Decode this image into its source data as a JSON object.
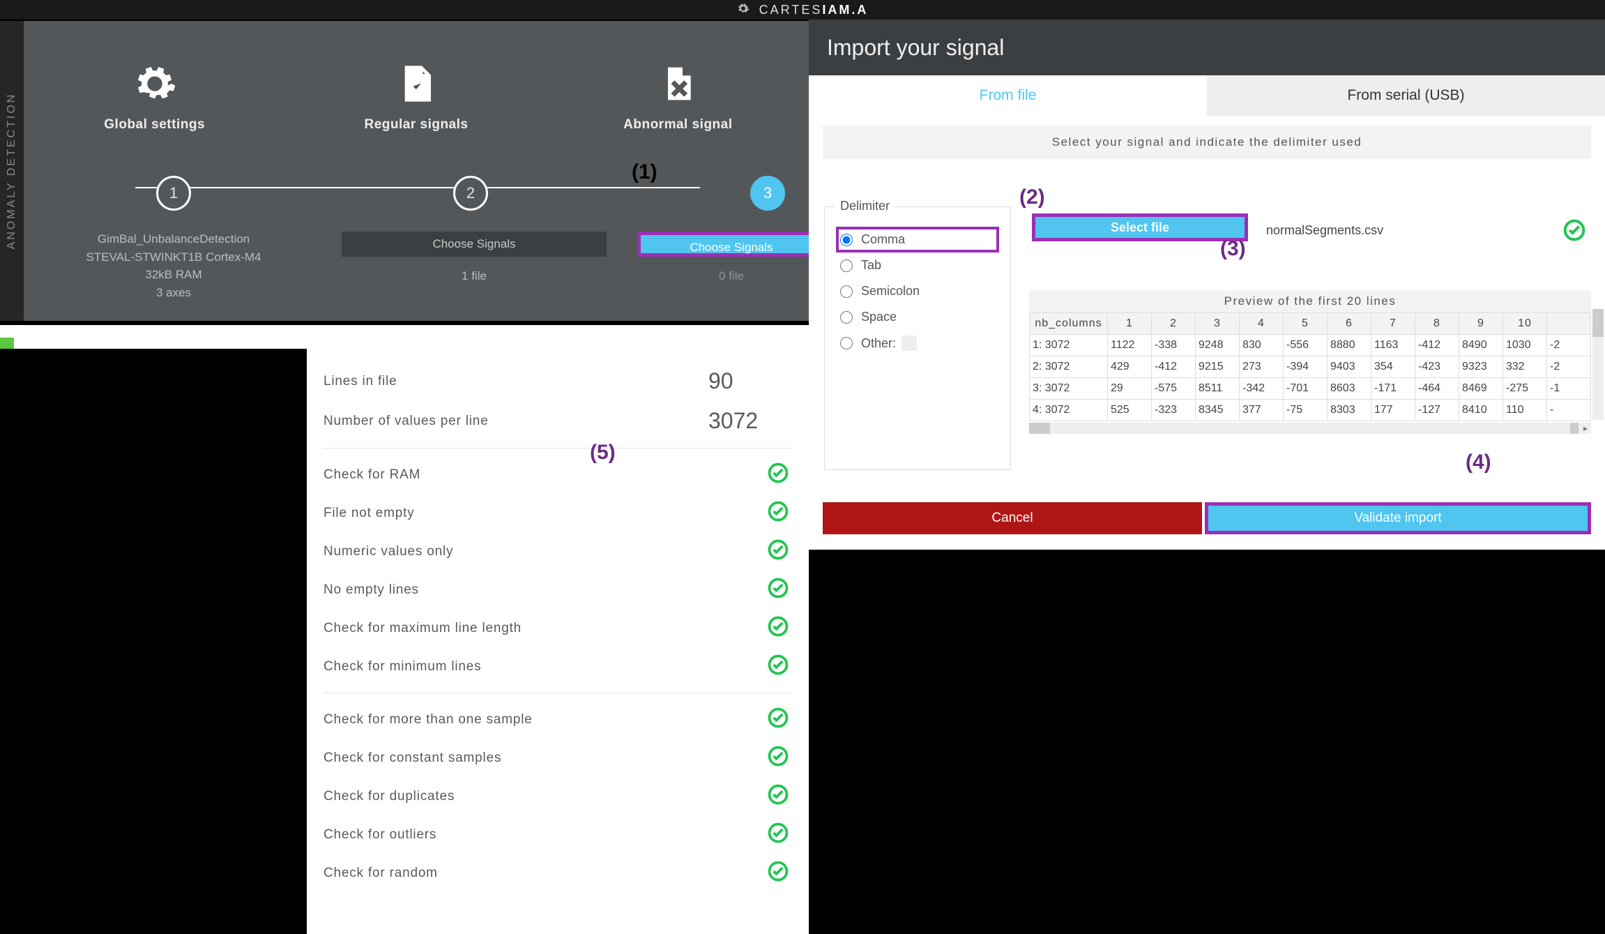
{
  "brand": {
    "pre": "CARTES",
    "bold": "IAM.A"
  },
  "side_label": "ANOMALY DETECTION",
  "wizard": {
    "cols": [
      {
        "title": "Global settings"
      },
      {
        "title": "Regular signals"
      },
      {
        "title": "Abnormal signal"
      }
    ],
    "settings_lines": [
      "GimBal_UnbalanceDetection",
      "STEVAL-STWINKT1B Cortex-M4",
      "32kB RAM",
      "3 axes"
    ],
    "choose1": "Choose Signals",
    "choose2": "Choose Signals",
    "fc1": "1 file",
    "fc2": "0 file"
  },
  "validation": {
    "lines_label": "Lines in file",
    "lines_value": "90",
    "nvals_label": "Number of values per line",
    "nvals_value": "3072",
    "checks_a": [
      "Check for RAM",
      "File not empty",
      "Numeric values only",
      "No empty lines",
      "Check for maximum line length",
      "Check for minimum lines"
    ],
    "checks_b": [
      "Check for more than one sample",
      "Check for constant samples",
      "Check for duplicates",
      "Check for outliers",
      "Check for random"
    ]
  },
  "modal": {
    "title": "Import your signal",
    "tab_file": "From file",
    "tab_serial": "From serial (USB)",
    "hint": "Select your signal and indicate the delimiter used",
    "delimiter_legend": "Delimiter",
    "delims": [
      "Comma",
      "Tab",
      "Semicolon",
      "Space",
      "Other:"
    ],
    "select_file": "Select file",
    "filename": "normalSegments.csv",
    "preview_title": "Preview of the first 20 lines",
    "headers": [
      "nb_columns",
      "1",
      "2",
      "3",
      "4",
      "5",
      "6",
      "7",
      "8",
      "9",
      "10",
      ""
    ],
    "rows": [
      [
        "1: 3072",
        "1122",
        "-338",
        "9248",
        "830",
        "-556",
        "8880",
        "1163",
        "-412",
        "8490",
        "1030",
        "-2"
      ],
      [
        "2: 3072",
        "429",
        "-412",
        "9215",
        "273",
        "-394",
        "9403",
        "354",
        "-423",
        "9323",
        "332",
        "-2"
      ],
      [
        "3: 3072",
        "29",
        "-575",
        "8511",
        "-342",
        "-701",
        "8603",
        "-171",
        "-464",
        "8469",
        "-275",
        "-1"
      ],
      [
        "4: 3072",
        "525",
        "-323",
        "8345",
        "377",
        "-75",
        "8303",
        "177",
        "-127",
        "8410",
        "110",
        "- "
      ]
    ],
    "cancel": "Cancel",
    "validate": "Validate import"
  },
  "annotations": {
    "a1": "(1)",
    "a2": "(2)",
    "a3": "(3)",
    "a4": "(4)",
    "a5": "(5)"
  }
}
